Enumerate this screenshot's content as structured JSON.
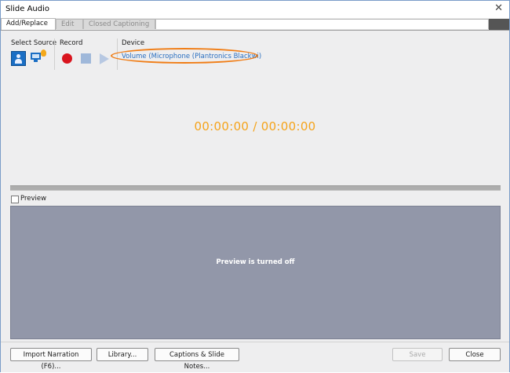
{
  "window": {
    "title": "Slide Audio",
    "close_glyph": "✕"
  },
  "tabs": [
    {
      "label": "Add/Replace",
      "active": true
    },
    {
      "label": "Edit",
      "active": false
    },
    {
      "label": "Closed Captioning",
      "active": false
    }
  ],
  "toolbar": {
    "select_source_label": "Select Source",
    "record_label": "Record",
    "device_label": "Device",
    "device_value": "Volume (Microphone (Plantronics Blackwi)",
    "icons": [
      "microphone-source-icon",
      "computer-source-icon",
      "record-icon",
      "stop-icon",
      "play-icon"
    ]
  },
  "timer": {
    "display": "00:00:00 / 00:00:00"
  },
  "progress": {
    "value": 0
  },
  "preview": {
    "checkbox_label": "Preview",
    "checked": false,
    "message": "Preview is turned off"
  },
  "footer": {
    "import_label": "Import Narration (F6)...",
    "library_label": "Library...",
    "captions_label": "Captions & Slide Notes...",
    "save_label": "Save",
    "close_label": "Close"
  },
  "colors": {
    "accent_orange": "#f5a31a",
    "highlight_ring": "#f07d16",
    "record_red": "#d9141e",
    "link_blue": "#2a6fc0",
    "preview_bg": "#9297a9"
  }
}
